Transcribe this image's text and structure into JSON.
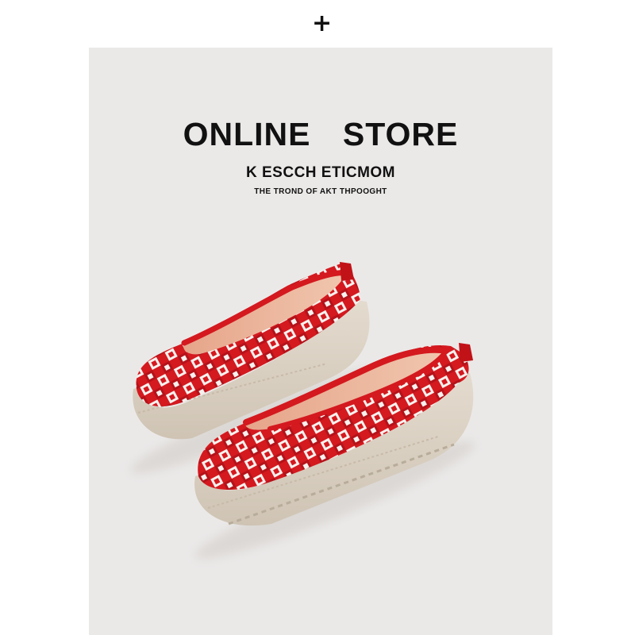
{
  "header": {
    "icon": "plus-icon",
    "plus_glyph": "+"
  },
  "banner": {
    "title": "ONLINE STORE",
    "subtitle": "K ESCCH ETICMOM",
    "tagline": "THE TROND OF AKT THPOOGHT"
  },
  "product": {
    "description_icon": "red-white-gingham-knit-flat-shoes",
    "colors": {
      "knit_red": "#d4191f",
      "knit_white": "#f6f1ee",
      "sole": "#ddd3c5",
      "insole": "#e9b49a",
      "background": "#ebe9e8"
    }
  }
}
